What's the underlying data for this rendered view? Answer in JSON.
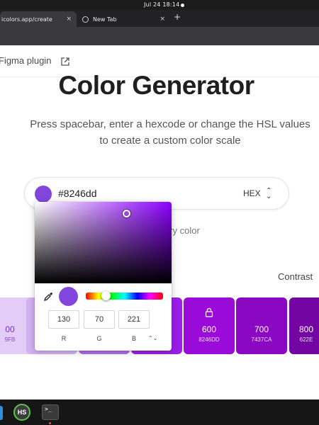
{
  "system": {
    "clock": "Jul 24  18:14"
  },
  "browser": {
    "tabs": [
      {
        "label": "icolors.app/create",
        "close": "×"
      },
      {
        "label": "New Tab",
        "close": "×"
      }
    ],
    "new_tab": "+"
  },
  "page": {
    "plugin_link": "Figma plugin",
    "title": "Color Generator",
    "subtitle": "Press spacebar, enter a hexcode or change the HSL values to create a custom color scale",
    "hex_input": {
      "value": "#8246dd",
      "mode": "HEX",
      "swatch_color": "#8246dd"
    },
    "primary_hint": "ary color",
    "contrast_label": "Contrast",
    "swatches": [
      {
        "num": "00",
        "hex": "9FB",
        "color": "#e3cdf8",
        "text_color": "#7b2fc9"
      },
      {
        "num": "",
        "hex": "",
        "color": "#d6b2f5",
        "text_color": "#ffffff"
      },
      {
        "num": "",
        "hex": "",
        "color": "#b46cec",
        "text_color": "#ffffff"
      },
      {
        "num": "",
        "hex": "",
        "color": "#9b1ee8",
        "text_color": "#ffffff"
      },
      {
        "num": "600",
        "hex": "8246DD",
        "color": "#9a0ad8",
        "text_color": "#ffffff",
        "locked": true
      },
      {
        "num": "700",
        "hex": "7437CA",
        "color": "#8a08c2",
        "text_color": "#ffffff"
      },
      {
        "num": "800",
        "hex": "622E",
        "color": "#7306a3",
        "text_color": "#ffffff"
      }
    ]
  },
  "picker": {
    "current_color": "#8246dd",
    "rgb": {
      "r": "130",
      "g": "70",
      "b": "221"
    },
    "labels": {
      "r": "R",
      "g": "G",
      "b": "B"
    },
    "mode_toggle": "⌃⌄"
  },
  "dock": {
    "hs_label": "HS",
    "terminal_label": ">_"
  },
  "icons": [
    "external-link-icon",
    "chevron-updown-icon",
    "eyedropper-icon",
    "lock-icon",
    "globe-icon",
    "terminal-icon"
  ]
}
